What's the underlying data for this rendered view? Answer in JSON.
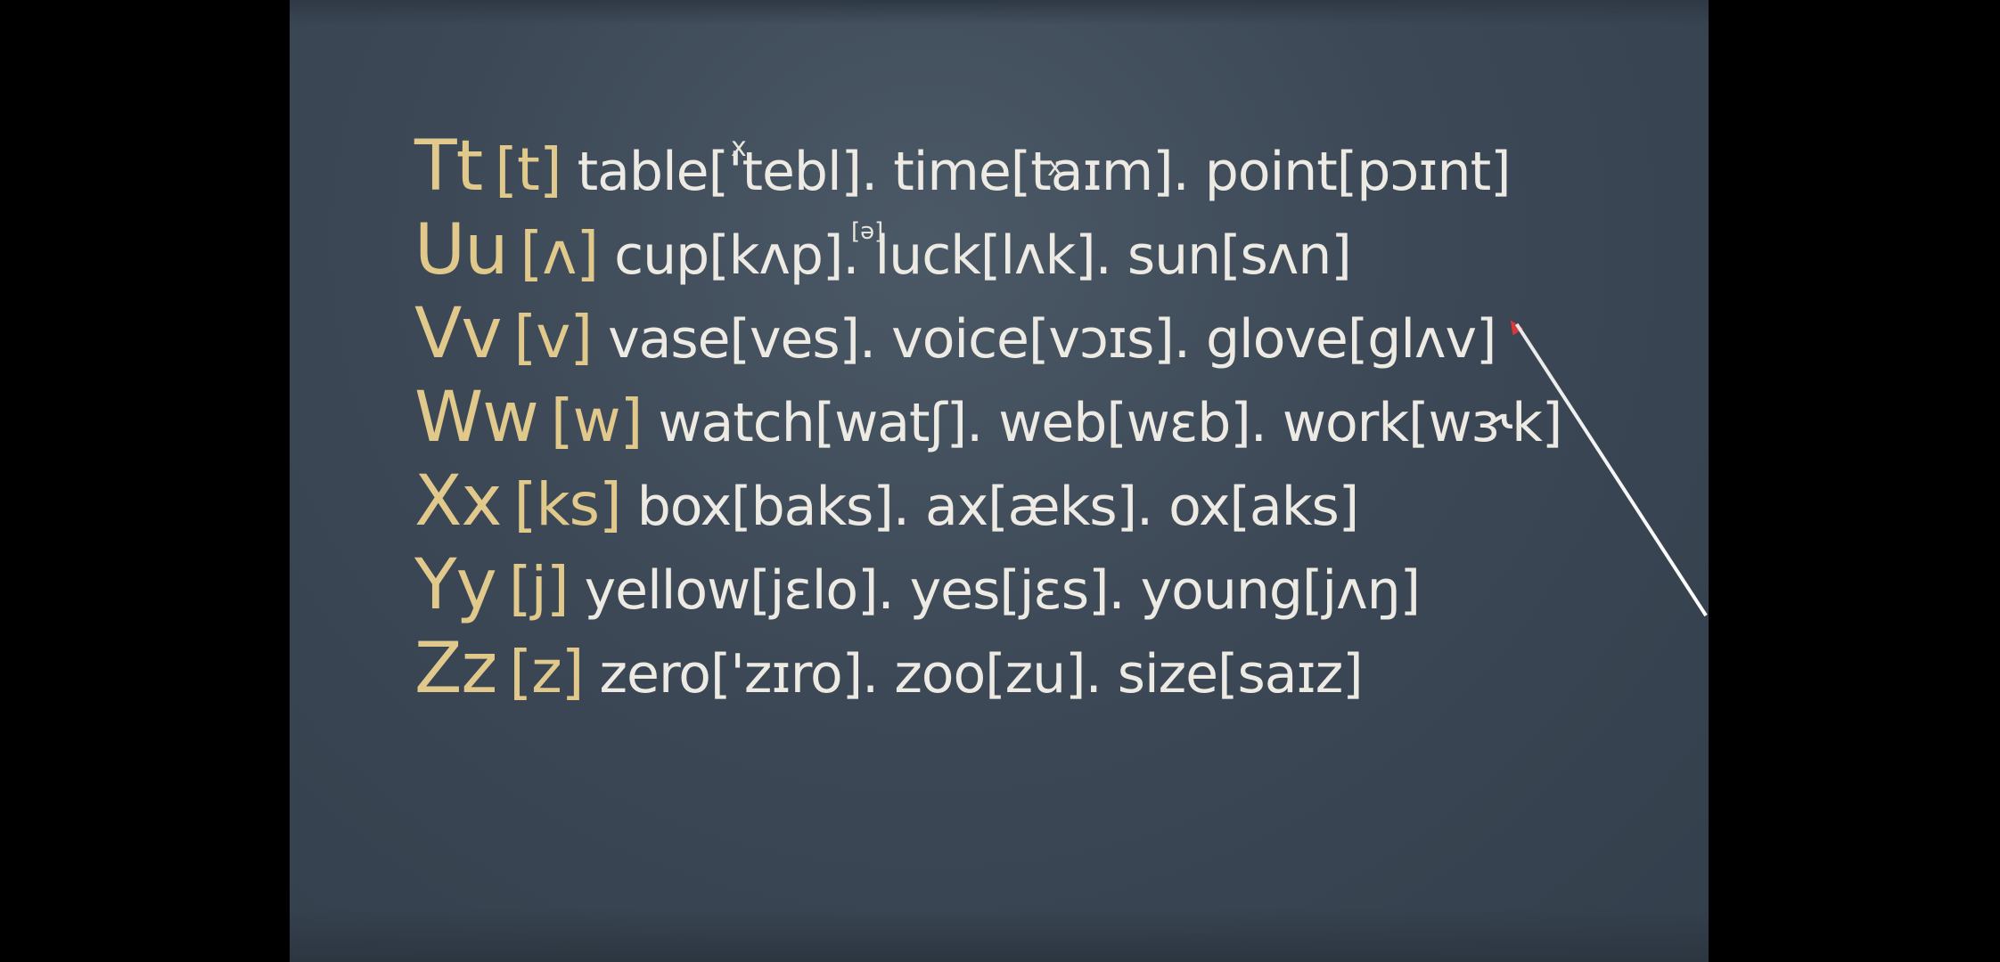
{
  "board": {
    "rows": [
      {
        "letter": "Tt",
        "ipa": "[t]",
        "words": "table['tebl]. time[taɪm]. point[pɔɪnt]"
      },
      {
        "letter": "Uu",
        "ipa": "[ʌ]",
        "words": "cup[kʌp]. luck[lʌk]. sun[sʌn]"
      },
      {
        "letter": "Vv",
        "ipa": "[v]",
        "words": "vase[ves]. voice[vɔɪs]. glove[glʌv]"
      },
      {
        "letter": "Ww",
        "ipa": "[w]",
        "words": "watch[watʃ]. web[wɛb]. work[wɝk]"
      },
      {
        "letter": "Xx",
        "ipa": "[ks]",
        "words": "box[baks]. ax[æks]. ox[aks]"
      },
      {
        "letter": "Yy",
        "ipa": "[j]",
        "words": "yellow[jɛlo]. yes[jɛs]. young[jʌŋ]"
      },
      {
        "letter": "Zz",
        "ipa": "[z]",
        "words": "zero['zɪro]. zoo[zu]. size[saɪz]"
      }
    ],
    "annotations": {
      "mark_table": "x",
      "mark_time": "x",
      "schwa_note": "[ə]"
    }
  },
  "colors": {
    "background": "#000000",
    "chalkboard": "#3c4856",
    "chalk_white": "#eceae3",
    "chalk_yellow": "#e0c98a",
    "pointer_tip": "#d43a3a"
  }
}
